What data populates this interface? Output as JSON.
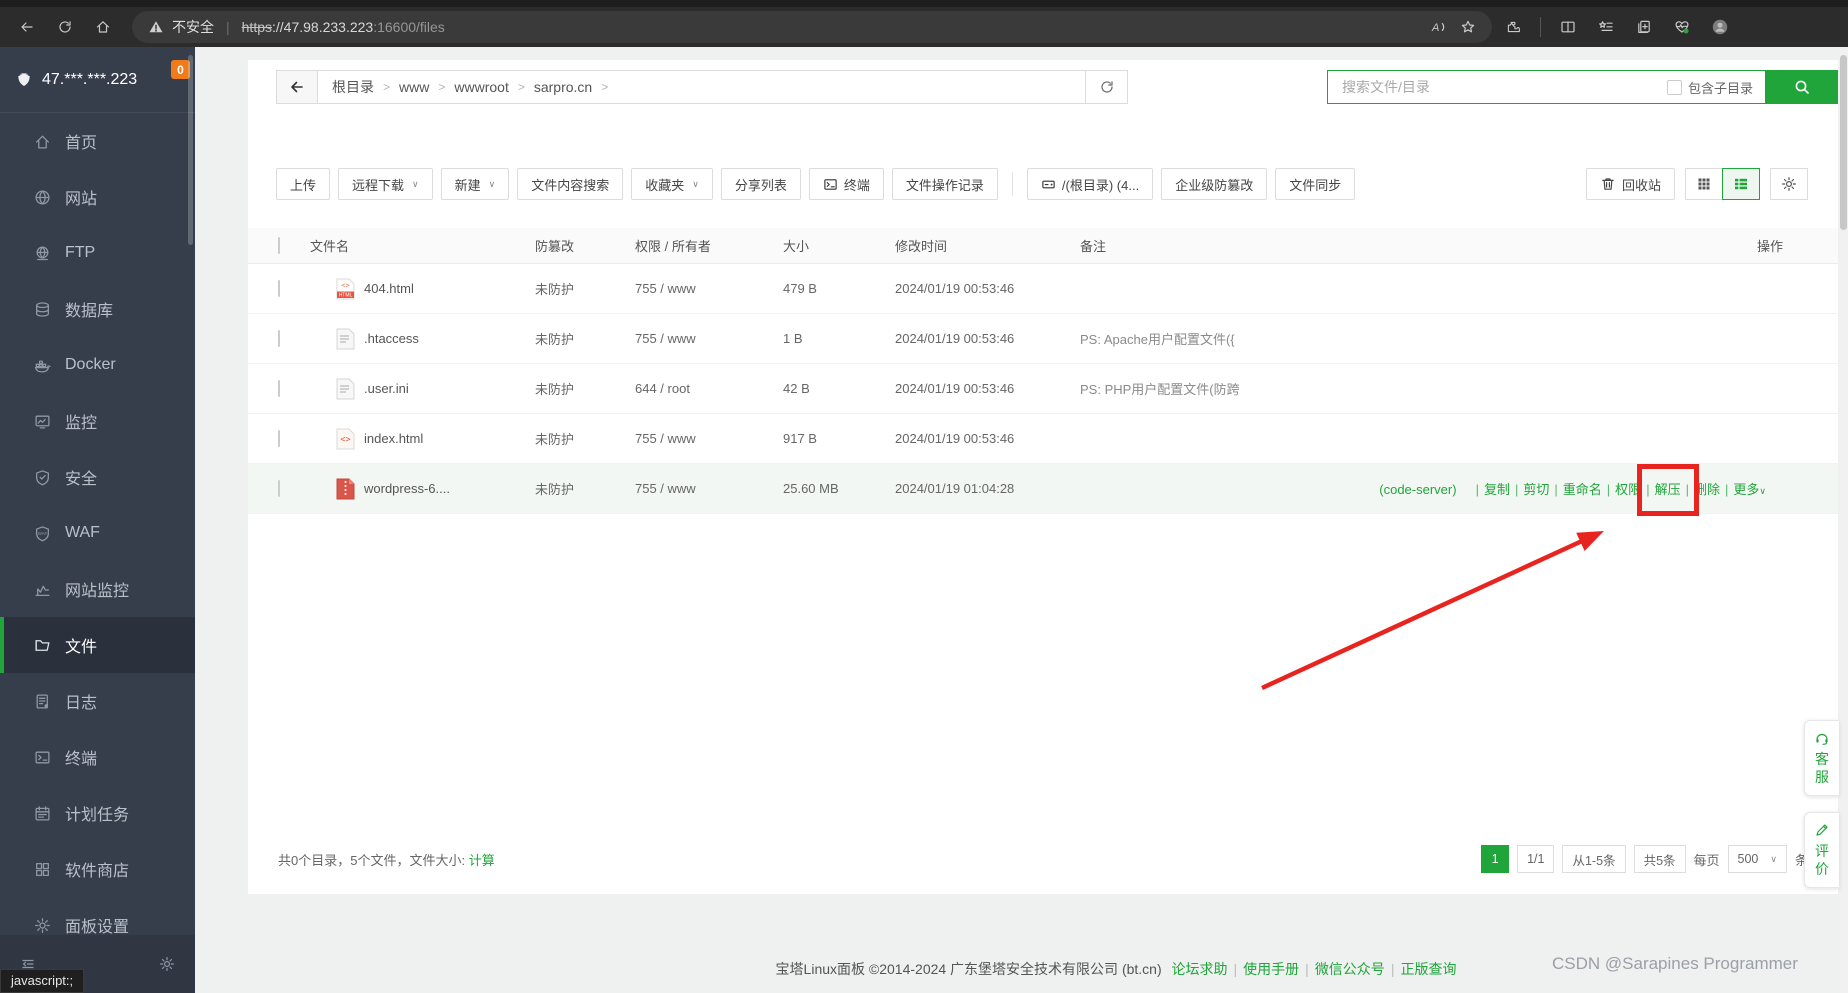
{
  "browser": {
    "security_label": "不安全",
    "url_protocol": "https",
    "url_main": "://47.98.233.223",
    "url_dim": ":16600/files"
  },
  "sidebar": {
    "server_ip": "47.***.***.223",
    "badge": "0",
    "items": [
      {
        "id": "home",
        "label": "首页",
        "icon": "home-icon",
        "active": false
      },
      {
        "id": "website",
        "label": "网站",
        "icon": "globe-icon",
        "active": false
      },
      {
        "id": "ftp",
        "label": "FTP",
        "icon": "ftp-icon",
        "active": false
      },
      {
        "id": "database",
        "label": "数据库",
        "icon": "database-icon",
        "active": false
      },
      {
        "id": "docker",
        "label": "Docker",
        "icon": "docker-icon",
        "active": false
      },
      {
        "id": "monitor",
        "label": "监控",
        "icon": "monitor-icon",
        "active": false
      },
      {
        "id": "security",
        "label": "安全",
        "icon": "shield-check-icon",
        "active": false
      },
      {
        "id": "waf",
        "label": "WAF",
        "icon": "waf-shield-icon",
        "active": false
      },
      {
        "id": "site-monitor",
        "label": "网站监控",
        "icon": "chart-icon",
        "active": false
      },
      {
        "id": "files",
        "label": "文件",
        "icon": "folder-icon",
        "active": true
      },
      {
        "id": "logs",
        "label": "日志",
        "icon": "log-icon",
        "active": false
      },
      {
        "id": "terminal",
        "label": "终端",
        "icon": "terminal-icon",
        "active": false
      },
      {
        "id": "cron",
        "label": "计划任务",
        "icon": "calendar-icon",
        "active": false
      },
      {
        "id": "appstore",
        "label": "软件商店",
        "icon": "grid-icon",
        "active": false
      },
      {
        "id": "settings",
        "label": "面板设置",
        "icon": "gear-icon",
        "active": false
      }
    ]
  },
  "breadcrumb": {
    "parts": [
      "根目录",
      "www",
      "wwwroot",
      "sarpro.cn"
    ]
  },
  "search": {
    "placeholder": "搜索文件/目录",
    "checkbox_label": "包含子目录"
  },
  "toolbar": {
    "buttons": [
      {
        "label": "上传",
        "caret": false,
        "icon": ""
      },
      {
        "label": "远程下载",
        "caret": true,
        "icon": ""
      },
      {
        "label": "新建",
        "caret": true,
        "icon": ""
      },
      {
        "label": "文件内容搜索",
        "caret": false,
        "icon": ""
      },
      {
        "label": "收藏夹",
        "caret": true,
        "icon": ""
      },
      {
        "label": "分享列表",
        "caret": false,
        "icon": ""
      },
      {
        "label": "终端",
        "caret": false,
        "icon": "terminal-icon"
      },
      {
        "label": "文件操作记录",
        "caret": false,
        "icon": ""
      },
      {
        "divider": true
      },
      {
        "label": "/(根目录) (4...",
        "caret": false,
        "icon": "disk-icon"
      },
      {
        "label": "企业级防篡改",
        "caret": false,
        "icon": ""
      },
      {
        "label": "文件同步",
        "caret": false,
        "icon": ""
      }
    ],
    "recycle_label": "回收站"
  },
  "table": {
    "columns": [
      "文件名",
      "防篡改",
      "权限 / 所有者",
      "大小",
      "修改时间",
      "备注",
      "操作"
    ],
    "rows": [
      {
        "name": "404.html",
        "icon": "html-banner-file-icon",
        "tamper": "未防护",
        "owner": "755 / www",
        "size": "479 B",
        "mtime": "2024/01/19 00:53:46",
        "note": "",
        "highlight": false
      },
      {
        "name": ".htaccess",
        "icon": "text-file-icon",
        "tamper": "未防护",
        "owner": "755 / www",
        "size": "1 B",
        "mtime": "2024/01/19 00:53:46",
        "note": "PS: Apache用户配置文件({",
        "highlight": false
      },
      {
        "name": ".user.ini",
        "icon": "text-file-icon",
        "tamper": "未防护",
        "owner": "644 / root",
        "size": "42 B",
        "mtime": "2024/01/19 00:53:46",
        "note": "PS: PHP用户配置文件(防跨",
        "highlight": false
      },
      {
        "name": "index.html",
        "icon": "html-file-icon",
        "tamper": "未防护",
        "owner": "755 / www",
        "size": "917 B",
        "mtime": "2024/01/19 00:53:46",
        "note": "",
        "highlight": false
      },
      {
        "name": "wordpress-6....",
        "icon": "archive-file-icon",
        "tamper": "未防护",
        "owner": "755 / www",
        "size": "25.60 MB",
        "mtime": "2024/01/19 01:04:28",
        "note": "",
        "highlight": true,
        "actions_prefix": "(code-server)",
        "actions": [
          "复制",
          "剪切",
          "重命名",
          "权限",
          "解压",
          "删除",
          "更多"
        ]
      }
    ]
  },
  "pagination": {
    "summary_prefix": "共0个目录，5个文件，文件大小: ",
    "summary_link": "计算",
    "page": "1",
    "page_info": "1/1",
    "range": "从1-5条",
    "total": "共5条",
    "per_page_label": "每页",
    "per_page_value": "500",
    "per_page_suffix": "条"
  },
  "footer": {
    "copyright": "宝塔Linux面板 ©2014-2024 广东堡塔安全技术有限公司 (bt.cn)",
    "links": [
      "论坛求助",
      "使用手册",
      "微信公众号",
      "正版查询"
    ]
  },
  "watermark": "CSDN @Sarapines Programmer",
  "side_widgets": {
    "service_label": "客服",
    "service_icon": "headset-icon",
    "rate_label": "评价",
    "rate_icon": "edit-icon"
  },
  "status_tooltip": "javascript:;",
  "colors": {
    "accent_green": "#20a53a",
    "annotation_red": "#e8241f",
    "badge_orange": "#ef7b1a"
  }
}
